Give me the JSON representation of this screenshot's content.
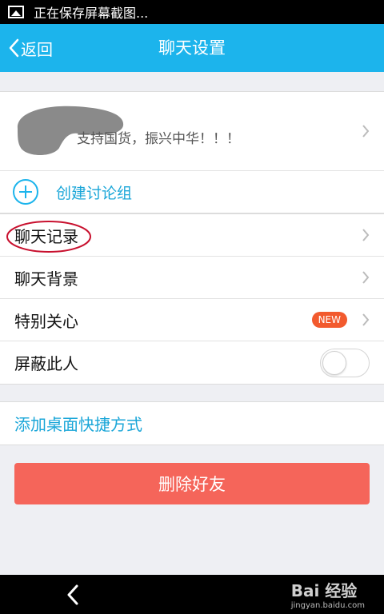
{
  "status_bar": {
    "text": "正在保存屏幕截图..."
  },
  "nav": {
    "back_label": "返回",
    "title": "聊天设置"
  },
  "profile": {
    "signature": "支持国货，振兴中华！！！"
  },
  "create_group": {
    "label": "创建讨论组"
  },
  "settings": {
    "items": [
      {
        "label": "聊天记录"
      },
      {
        "label": "聊天背景"
      },
      {
        "label": "特别关心",
        "badge": "NEW"
      },
      {
        "label": "屏蔽此人",
        "toggle": false
      }
    ]
  },
  "shortcut": {
    "label": "添加桌面快捷方式"
  },
  "delete_button": {
    "label": "删除好友"
  },
  "watermark": {
    "brand": "Bai 经验",
    "url": "jingyan.baidu.com"
  },
  "colors": {
    "accent": "#1cb4ec",
    "danger": "#f5655a",
    "badge": "#f25a2e",
    "annotation": "#c8102e"
  }
}
